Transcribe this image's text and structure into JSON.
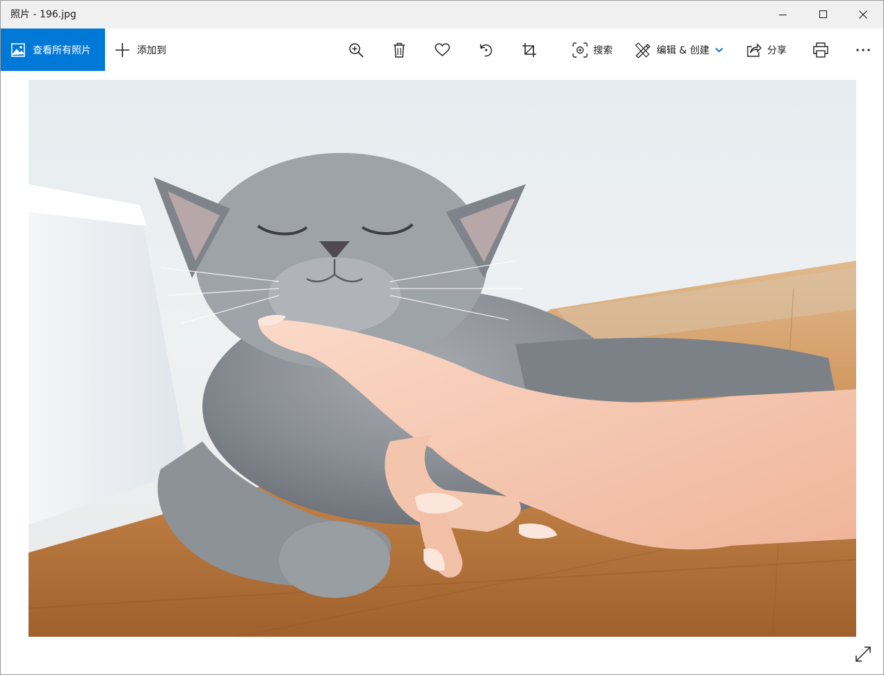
{
  "window": {
    "title": "照片 - 196.jpg",
    "controls": [
      "minimize-icon",
      "maximize-icon",
      "close-icon"
    ]
  },
  "toolbar": {
    "view_all_label": "查看所有照片",
    "add_to_label": "添加到",
    "search_label": "搜索",
    "edit_create_label": "编辑 & 创建",
    "share_label": "分享",
    "icons": [
      "zoom-in-icon",
      "delete-icon",
      "favorite-heart-icon",
      "rotate-icon",
      "crop-icon",
      "visual-search-icon",
      "edit-create-icon",
      "share-icon",
      "print-icon",
      "more-options-icon"
    ]
  },
  "colors": {
    "accent": "#0078d7",
    "titlebar_bg": "#f0f0f0",
    "canvas_bg": "#ffffff"
  },
  "photo": {
    "subject": "cat-being-scratched-photo"
  }
}
